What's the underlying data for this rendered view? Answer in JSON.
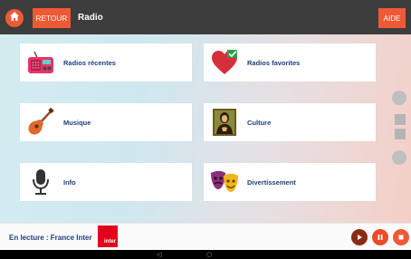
{
  "topbar": {
    "back_label": "RETOUR",
    "title": "Radio",
    "help_label": "AIDE"
  },
  "tiles": [
    {
      "label": "Radios récentes",
      "icon": "radio-icon"
    },
    {
      "label": "Radios favorites",
      "icon": "heart-icon"
    },
    {
      "label": "Musique",
      "icon": "guitar-icon"
    },
    {
      "label": "Culture",
      "icon": "mona-lisa-icon"
    },
    {
      "label": "Info",
      "icon": "microphone-icon"
    },
    {
      "label": "Divertissement",
      "icon": "theatre-masks-icon"
    }
  ],
  "player": {
    "now_playing": "En lecture : France Inter",
    "station_logo_text": "inter"
  },
  "colors": {
    "accent": "#ee5a35",
    "topbar": "#3d3d3d",
    "label": "#1f3e7a"
  }
}
